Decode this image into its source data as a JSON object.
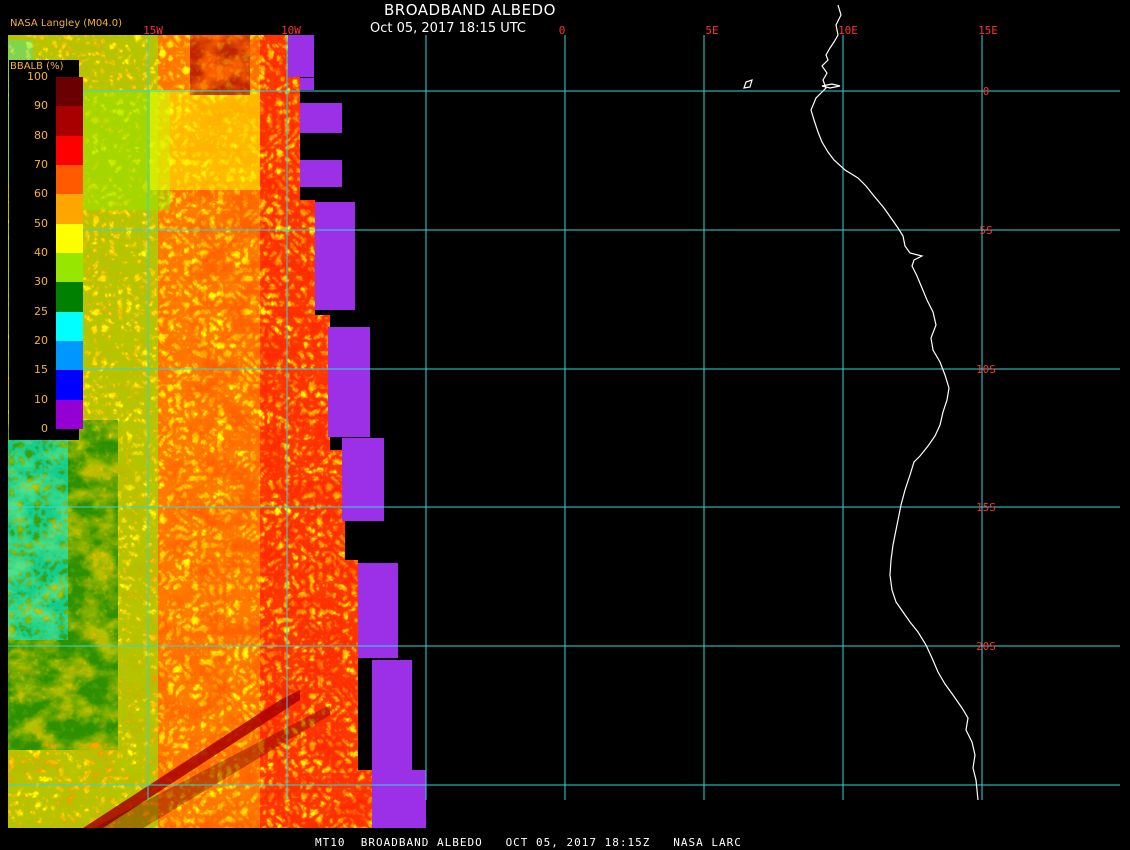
{
  "header": {
    "title": "BROADBAND ALBEDO",
    "subtitle": "Oct 05, 2017 18:15 UTC",
    "source": "NASA Langley (M04.0)"
  },
  "footer": {
    "caption": "MT10  BROADBAND ALBEDO   OCT 05, 2017 18:15Z   NASA LARC"
  },
  "legend": {
    "title": "BBALB (%)",
    "ticks": [
      "100",
      "90",
      "80",
      "70",
      "60",
      "50",
      "40",
      "30",
      "25",
      "20",
      "15",
      "10",
      "0"
    ],
    "colors": [
      "#6b0000",
      "#a80000",
      "#ff0000",
      "#ff5a00",
      "#ffa500",
      "#ffff00",
      "#96e600",
      "#008000",
      "#00ffff",
      "#0096ff",
      "#0000ff",
      "#9400d3"
    ]
  },
  "map": {
    "lon_labels": [
      "15W",
      "10W",
      "0",
      "5E",
      "10E",
      "15E"
    ],
    "lat_labels": [
      "0",
      "5S",
      "10S",
      "15S",
      "20S"
    ],
    "grid_color": "#2fd7d7",
    "coast_color": "#ffffff",
    "label_color": "#ff3030"
  },
  "colors": {
    "no_data": "#9b30e6",
    "background": "#000000"
  }
}
